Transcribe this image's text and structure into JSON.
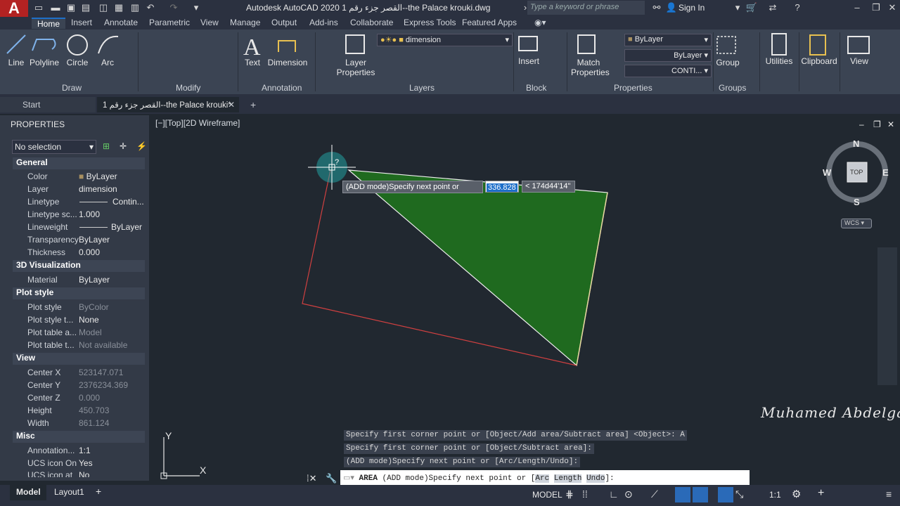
{
  "app": {
    "title": "Autodesk AutoCAD 2020  القصر جزء رقم 1--the Palace krouki.dwg",
    "search_placeholder": "Type a keyword or phrase",
    "sign_in": "Sign In"
  },
  "ribbon_tabs": [
    "Home",
    "Insert",
    "Annotate",
    "Parametric",
    "View",
    "Manage",
    "Output",
    "Add-ins",
    "Collaborate",
    "Express Tools",
    "Featured Apps"
  ],
  "ribbon": {
    "draw": {
      "label": "Draw",
      "tools": [
        "Line",
        "Polyline",
        "Circle",
        "Arc"
      ]
    },
    "modify": {
      "label": "Modify"
    },
    "annotation": {
      "label": "Annotation",
      "tools": [
        "Text",
        "Dimension"
      ]
    },
    "layers": {
      "label": "Layers",
      "layer_properties": "Layer\nProperties",
      "current_layer": "dimension"
    },
    "block": {
      "label": "Block",
      "insert": "Insert"
    },
    "properties": {
      "label": "Properties",
      "match": "Match\nProperties",
      "color": "ByLayer",
      "linetype": "ByLayer",
      "linetype2": "CONTI..."
    },
    "groups": {
      "label": "Groups",
      "group": "Group"
    },
    "utilities": "Utilities",
    "clipboard": "Clipboard",
    "view": "View"
  },
  "doc_tabs": {
    "start": "Start",
    "active": "القصر جزء رقم 1--the Palace krouki*"
  },
  "properties_panel": {
    "title": "PROPERTIES",
    "selection": "No selection",
    "sections": [
      {
        "name": "General",
        "rows": [
          [
            "Color",
            "ByLayer"
          ],
          [
            "Layer",
            "dimension"
          ],
          [
            "Linetype",
            "Contin..."
          ],
          [
            "Linetype sc...",
            "1.000"
          ],
          [
            "Lineweight",
            "ByLayer"
          ],
          [
            "Transparency",
            "ByLayer"
          ],
          [
            "Thickness",
            "0.000"
          ]
        ]
      },
      {
        "name": "3D Visualization",
        "rows": [
          [
            "Material",
            "ByLayer"
          ]
        ]
      },
      {
        "name": "Plot style",
        "rows": [
          [
            "Plot style",
            "ByColor"
          ],
          [
            "Plot style t...",
            "None"
          ],
          [
            "Plot table a...",
            "Model"
          ],
          [
            "Plot table t...",
            "Not available"
          ]
        ]
      },
      {
        "name": "View",
        "rows": [
          [
            "Center X",
            "523147.071"
          ],
          [
            "Center Y",
            "2376234.369"
          ],
          [
            "Center Z",
            "0.000"
          ],
          [
            "Height",
            "450.703"
          ],
          [
            "Width",
            "861.124"
          ]
        ]
      },
      {
        "name": "Misc",
        "rows": [
          [
            "Annotation...",
            "1:1"
          ],
          [
            "UCS icon On",
            "Yes"
          ],
          [
            "UCS icon at",
            "No"
          ]
        ]
      }
    ]
  },
  "viewport": {
    "label": "[−][Top][2D Wireframe]",
    "tooltip": "(ADD mode)Specify next point or",
    "distance": "336.828",
    "angle": "< 174d44'14\"",
    "compass": {
      "n": "N",
      "s": "S",
      "e": "E",
      "w": "W",
      "top": "TOP",
      "wcs": "WCS"
    },
    "ucs_x": "X",
    "ucs_y": "Y"
  },
  "command_history": [
    "Specify first corner point or [Object/Add area/Subtract area] <Object>: A",
    "Specify first corner point or [Object/Subtract area]:",
    " (ADD mode)Specify next point or [Arc/Length/Undo]:"
  ],
  "command_line": {
    "cmd": "AREA",
    "prompt": " (ADD mode)Specify next point or [",
    "opt1": "Arc",
    "opt2": "Length",
    "opt3": "Undo",
    "end": "]:"
  },
  "status": {
    "model_tab": "Model",
    "layout_tab": "Layout1",
    "model_btn": "MODEL",
    "scale": "1:1"
  },
  "signature": "Muhamed Abdelgalil"
}
